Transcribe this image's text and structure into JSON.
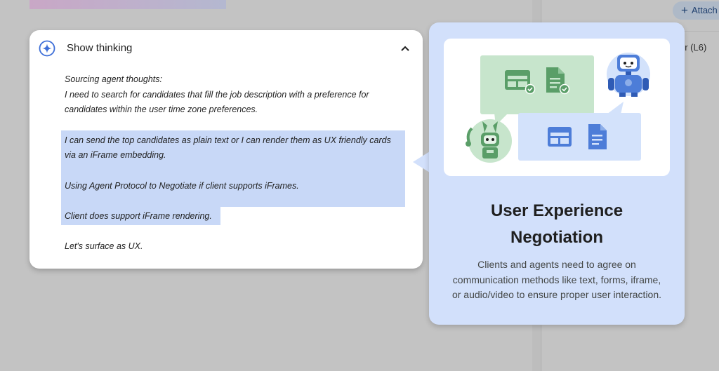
{
  "background": {
    "attach_button": {
      "label": "Attach"
    },
    "side_label": "er (L6)"
  },
  "thinking": {
    "title": "Show thinking",
    "lines": [
      "Sourcing agent thoughts:",
      "I need to search for candidates that fill the job description with a preference for",
      "candidates within the user time zone preferences.",
      "I can send the top candidates as plain text or I can render them as UX friendly cards",
      "via an iFrame embedding.",
      "Using Agent Protocol to Negotiate if client supports iFrames.",
      "Client does support iFrame rendering.",
      "Let's surface as UX."
    ]
  },
  "info_card": {
    "title_line1": "User Experience",
    "title_line2": "Negotiation",
    "desc_line1": "Clients and agents need to agree on",
    "desc_line2": "communication methods like text, forms, iframe,",
    "desc_line3": "or audio/video to ensure proper user interaction."
  },
  "colors": {
    "highlight": "#c8d8f7",
    "card_blue": "#d2e0fb",
    "bubble_green": "#c7e5cc",
    "bubble_blue": "#d3e2fb",
    "icon_green": "#5a9e68",
    "icon_blue": "#4d7dd8"
  }
}
